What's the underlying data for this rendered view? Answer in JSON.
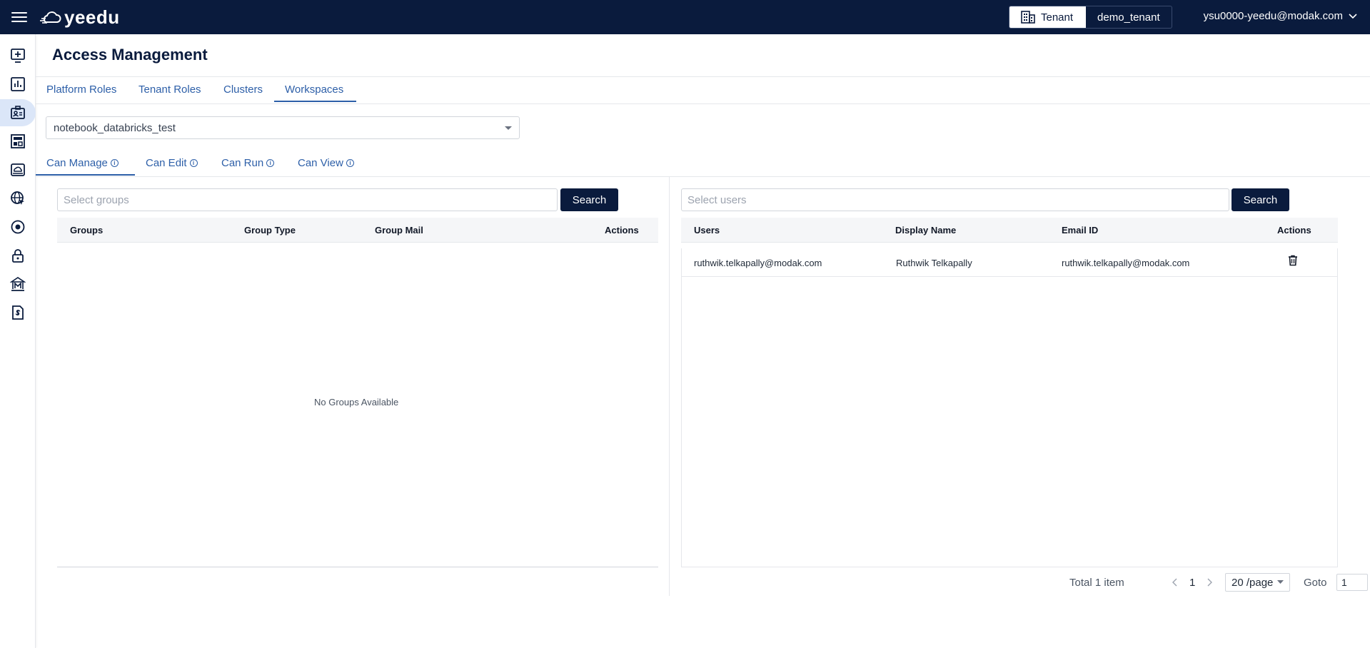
{
  "header": {
    "logo_text": "yeedu",
    "tenant_label": "Tenant",
    "tenant_value": "demo_tenant",
    "user_email": "ysu0000-yeedu@modak.com"
  },
  "sidebar": {
    "items": [
      {
        "icon": "add-monitor-icon"
      },
      {
        "icon": "bar-chart-icon"
      },
      {
        "icon": "id-card-icon"
      },
      {
        "icon": "layout-icon"
      },
      {
        "icon": "cloud-drive-icon"
      },
      {
        "icon": "globe-cursor-icon"
      },
      {
        "icon": "target-icon"
      },
      {
        "icon": "lock-icon"
      },
      {
        "icon": "bank-icon"
      },
      {
        "icon": "billing-document-icon"
      }
    ]
  },
  "page": {
    "title": "Access Management",
    "tabs": [
      "Platform Roles",
      "Tenant Roles",
      "Clusters",
      "Workspaces"
    ],
    "active_tab": "Workspaces",
    "workspace_selected": "notebook_databricks_test",
    "permission_tabs": [
      "Can Manage",
      "Can Edit",
      "Can Run",
      "Can View"
    ],
    "active_permission_tab": "Can Manage"
  },
  "groups": {
    "search_placeholder": "Select groups",
    "search_button": "Search",
    "columns": [
      "Groups",
      "Group Type",
      "Group Mail",
      "Actions"
    ],
    "empty_message": "No Groups Available"
  },
  "users": {
    "search_placeholder": "Select users",
    "search_button": "Search",
    "columns": [
      "Users",
      "Display Name",
      "Email ID",
      "Actions"
    ],
    "rows": [
      {
        "user": "ruthwik.telkapally@modak.com",
        "display_name": "Ruthwik Telkapally",
        "email": "ruthwik.telkapally@modak.com"
      }
    ]
  },
  "pagination": {
    "total": "Total 1 item",
    "current_page": "1",
    "page_size": "20 /page",
    "goto_label": "Goto",
    "goto_value": "1"
  }
}
